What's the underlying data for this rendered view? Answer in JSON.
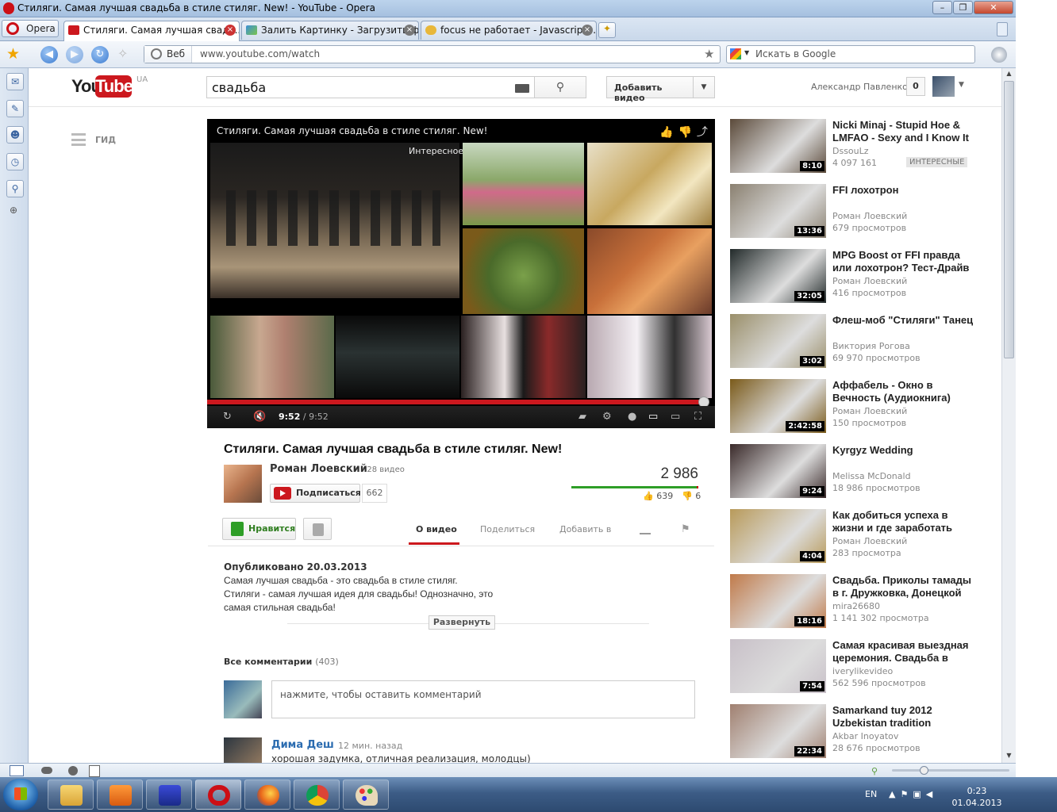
{
  "window": {
    "title": "Стиляги. Самая лучшая свадьба в стиле стиляг. New! - YouTube - Opera"
  },
  "browser": {
    "menu_label": "Opera",
    "tabs": [
      {
        "label": "Стиляги. Самая лучшая свадь..."
      },
      {
        "label": "Залить Картинку - Загрузить ф..."
      },
      {
        "label": "focus не работает - Javascript-..."
      }
    ],
    "address": {
      "scheme_label": "Веб",
      "url": "www.youtube.com/watch"
    },
    "search_placeholder": "Искать в Google"
  },
  "youtube": {
    "logo_region": "UA",
    "search_query": "свадьба",
    "upload_label": "Добавить видео",
    "user_name": "Александр Павленко",
    "notifications": "0",
    "guide_label": "ГИД"
  },
  "player": {
    "title": "Стиляги. Самая лучшая свадьба в стиле стиляг. New!",
    "interesting_label": "Интересное",
    "current_time": "9:52",
    "total_time": "/ 9:52",
    "progress": 0.985
  },
  "video": {
    "title": "Стиляги. Самая лучшая свадьба в стиле стиляг. New!",
    "channel": "Роман Лоевский",
    "channel_videos": "· 28 видео",
    "subscribe_label": "Подписаться",
    "subscribers": "662",
    "views": "2 986",
    "likes": "639",
    "dislikes": "6",
    "like_label": "Нравится",
    "tabs": [
      "О видео",
      "Поделиться",
      "Добавить в"
    ],
    "published": "Опубликовано 20.03.2013",
    "description": [
      "Самая лучшая свадьба - это свадьба в стиле стиляг.",
      "Стиляги - самая лучшая идея для свадьбы! Однозначно, это",
      "самая стильная свадьба!"
    ],
    "expand_label": "Развернуть"
  },
  "comments": {
    "header": "Все комментарии",
    "count": "(403)",
    "placeholder": "нажмите, чтобы оставить комментарий",
    "items": [
      {
        "author": "Дима Деш",
        "time": "12 мин. назад",
        "text": "хорошая задумка, отличная реализация, молодцы)"
      }
    ]
  },
  "sidebar": [
    {
      "title": "Nicki Minaj - Stupid Hoe & LMFAO - Sexy and I Know It",
      "channel": "DssouLz",
      "views": "4 097 161",
      "badge": "ИНТЕРЕСНЫЕ",
      "duration": "8:10",
      "color": "#5b4a3a"
    },
    {
      "title": "FFI лохотрон",
      "channel": "Роман Лоевский",
      "views": "679 просмотров",
      "badge": "",
      "duration": "13:36",
      "color": "#8a8070"
    },
    {
      "title": "MPG Boost от FFI правда или лохотрон? Тест-Драйв",
      "channel": "Роман Лоевский",
      "views": "416 просмотров",
      "badge": "",
      "duration": "32:05",
      "color": "#222a2a"
    },
    {
      "title": "Флеш-моб \"Стиляги\" Танец",
      "channel": "Виктория Рогова",
      "views": "69 970 просмотров",
      "badge": "",
      "duration": "3:02",
      "color": "#9a8f6a"
    },
    {
      "title": "Аффабель - Окно в Вечность (Аудиокнига)",
      "channel": "Роман Лоевский",
      "views": "150 просмотров",
      "badge": "",
      "duration": "2:42:58",
      "color": "#7a5a1a"
    },
    {
      "title": "Kyrgyz Wedding",
      "channel": "Melissa McDonald",
      "views": "18 986 просмотров",
      "badge": "",
      "duration": "9:24",
      "color": "#3a2a2a"
    },
    {
      "title": "Как добиться успеха в жизни и где заработать",
      "channel": "Роман Лоевский",
      "views": "283 просмотра",
      "badge": "",
      "duration": "4:04",
      "color": "#b89a5a"
    },
    {
      "title": "Свадьба. Приколы тамады в г. Дружковка, Донецкой",
      "channel": "mira26680",
      "views": "1 141 302 просмотра",
      "badge": "",
      "duration": "18:16",
      "color": "#c07a4a"
    },
    {
      "title": "Самая красивая выездная церемония. Свадьба в",
      "channel": "iverylikevideo",
      "views": "562 596 просмотров",
      "badge": "",
      "duration": "7:54",
      "color": "#c8c0c8"
    },
    {
      "title": "Samarkand tuy 2012 Uzbekistan tradition",
      "channel": "Akbar Inoyatov",
      "views": "28 676 просмотров",
      "badge": "",
      "duration": "22:34",
      "color": "#a08070"
    }
  ],
  "taskbar": {
    "lang": "EN",
    "time": "0:23",
    "date": "01.04.2013"
  }
}
